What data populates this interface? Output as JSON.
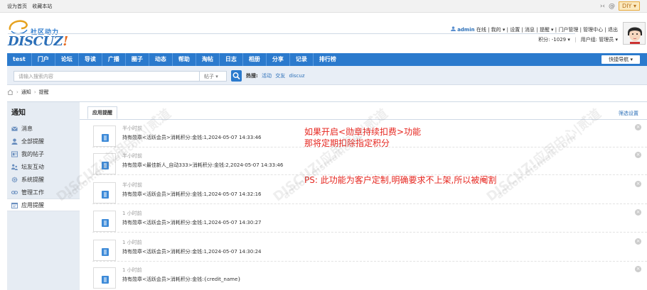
{
  "topbar": {
    "link1": "设为首页",
    "link2": "收藏本站",
    "diy": "DIY"
  },
  "logo": {
    "sub": "社区动力",
    "main_a": "DISCUZ",
    "main_b": "!"
  },
  "user": {
    "name": "admin",
    "status": "在线",
    "menu": "| 我的 ▾ | 设置 | 消息 | 提醒 ▾ | 门户管理 | 管理中心 | 退出",
    "credit": "积分: -1029 ▾",
    "group": "用户组: 管理员 ▾"
  },
  "nav": {
    "items": [
      "test",
      "门户",
      "论坛",
      "导读",
      "广播",
      "圈子",
      "动态",
      "帮助",
      "淘帖",
      "日志",
      "相册",
      "分享",
      "记录",
      "排行榜"
    ],
    "quick": "快捷导航 ▾"
  },
  "search": {
    "placeholder": "请输入搜索内容",
    "type": "帖子 ▾",
    "hot_label": "热搜:",
    "hot": [
      "活动",
      "交友",
      "discuz"
    ]
  },
  "breadcrumb": {
    "a": "通知",
    "b": "提醒"
  },
  "sidebar": {
    "title": "通知",
    "items": [
      "消息",
      "全部提醒",
      "我的帖子",
      "坛友互动",
      "系统提醒",
      "管理工作",
      "应用提醒"
    ]
  },
  "main": {
    "tab": "应用提醒",
    "filter": "筛选设置"
  },
  "notices": [
    {
      "time": "半小时前",
      "text": "持有勋章<活跃会员>消耗积分:金钱:1,2024-05-07 14:33:46"
    },
    {
      "time": "半小时前",
      "text": "持有勋章<最佳新人_自动333>消耗积分:金钱:2,2024-05-07 14:33:46"
    },
    {
      "time": "半小时前",
      "text": "持有勋章<活跃会员>消耗积分:金钱:1,2024-05-07 14:32:16"
    },
    {
      "time": "1 小时前",
      "text": "持有勋章<活跃会员>消耗积分:金钱:1,2024-05-07 14:30:27"
    },
    {
      "time": "1 小时前",
      "text": "持有勋章<活跃会员>消耗积分:金钱:1,2024-05-07 14:30:24"
    },
    {
      "time": "1 小时前",
      "text": "持有勋章<活跃会员>消耗积分:金钱:{credit_name}"
    }
  ],
  "annotation": {
    "line1": "如果开启<勋章持续扣费>功能",
    "line2": "那将定期扣除指定积分",
    "line3": "PS: 此功能为客户定制,明确要求不上架,所以被阉割"
  },
  "watermark": {
    "text1": "DISCUZ!应用中心|贰道",
    "text2": "addon.dismall.com"
  }
}
